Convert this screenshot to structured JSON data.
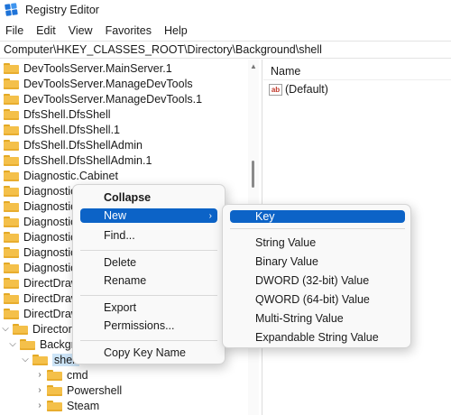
{
  "window": {
    "title": "Registry Editor",
    "icon": "registry-cubes-icon"
  },
  "menubar": [
    "File",
    "Edit",
    "View",
    "Favorites",
    "Help"
  ],
  "address": "Computer\\HKEY_CLASSES_ROOT\\Directory\\Background\\shell",
  "tree": [
    "DevToolsServer.MainServer.1",
    "DevToolsServer.ManageDevTools",
    "DevToolsServer.ManageDevTools.1",
    "DfsShell.DfsShell",
    "DfsShell.DfsShell.1",
    "DfsShell.DfsShellAdmin",
    "DfsShell.DfsShellAdmin.1",
    "Diagnostic.Cabinet",
    "Diagnostic",
    "Diagnostic",
    "Diagnostic",
    "Diagnostic",
    "Diagnostic",
    "Diagnostic",
    "DirectDraw",
    "DirectDraw",
    "DirectDraw",
    "Directory",
    "Backgro",
    "shell",
    "cmd",
    "Powershell",
    "Steam"
  ],
  "values_pane": {
    "column_name": "Name",
    "entries": [
      {
        "icon": "ab-string-icon",
        "icon_text": "ab",
        "name": "(Default)"
      }
    ]
  },
  "context_menu": {
    "items": [
      {
        "label": "Collapse",
        "bold": true
      },
      {
        "label": "New",
        "highlighted": true,
        "submenu": true
      },
      {
        "label": "Find..."
      },
      {
        "label": "Delete"
      },
      {
        "label": "Rename"
      },
      {
        "label": "Export"
      },
      {
        "label": "Permissions..."
      },
      {
        "label": "Copy Key Name"
      }
    ],
    "submenu_arrow": "›"
  },
  "submenu": {
    "items": [
      {
        "label": "Key",
        "highlighted": true
      },
      {
        "label": "String Value"
      },
      {
        "label": "Binary Value"
      },
      {
        "label": "DWORD (32-bit) Value"
      },
      {
        "label": "QWORD (64-bit) Value"
      },
      {
        "label": "Multi-String Value"
      },
      {
        "label": "Expandable String Value"
      }
    ]
  },
  "colors": {
    "highlight": "#0c63c7",
    "folder": "#f4c04a",
    "selection": "#cce4f7"
  }
}
